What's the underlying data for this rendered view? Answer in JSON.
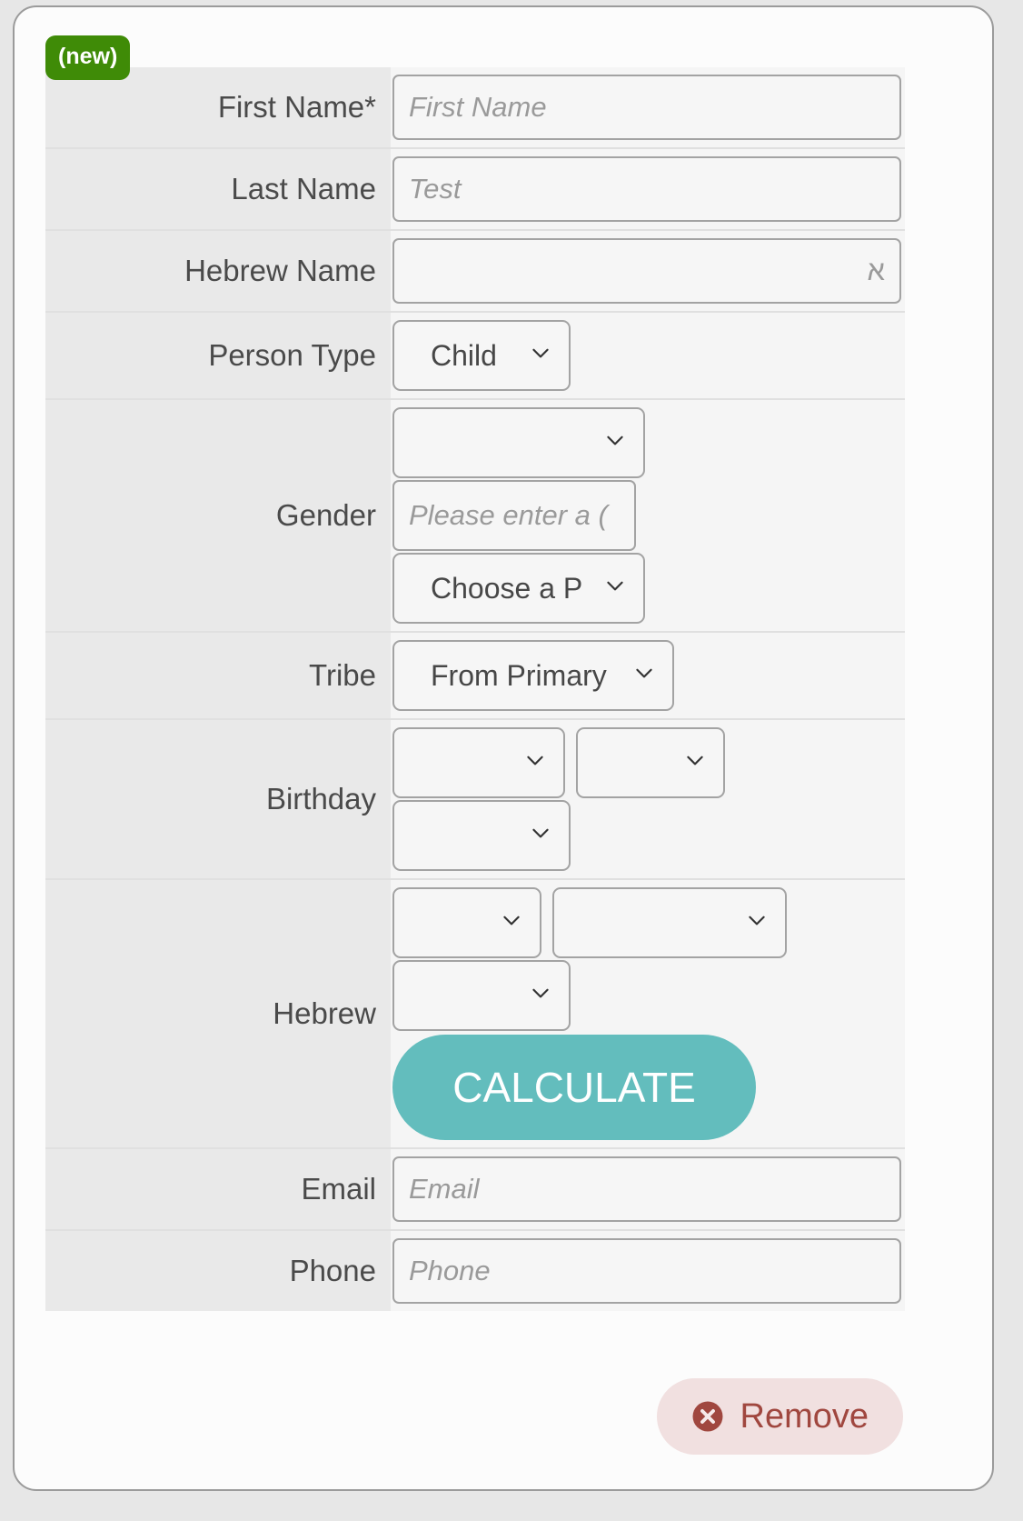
{
  "card": {
    "badge": "(new)",
    "accent_color": "#63bdbd",
    "badge_color": "#3f8b07",
    "remove_color": "#a0473f",
    "remove_bg": "#f1e0e0"
  },
  "fields": {
    "first_name": {
      "label": "First Name*",
      "placeholder": "First Name",
      "value": ""
    },
    "last_name": {
      "label": "Last Name",
      "placeholder": "Test",
      "value": ""
    },
    "hebrew_name": {
      "label": "Hebrew Name",
      "placeholder": "א",
      "value": ""
    },
    "person_type": {
      "label": "Person Type",
      "value": "Child"
    },
    "gender": {
      "label": "Gender",
      "select_value": "",
      "text_placeholder": "Please enter a (",
      "text_value": "",
      "parent_select_value": "Choose a P"
    },
    "tribe": {
      "label": "Tribe",
      "value": "From Primary"
    },
    "birthday": {
      "label": "Birthday",
      "month_value": "",
      "day_value": "",
      "year_value": ""
    },
    "hebrew": {
      "label": "Hebrew",
      "month_value": "",
      "day_value": "",
      "year_value": "",
      "calculate_label": "CALCULATE"
    },
    "email": {
      "label": "Email",
      "placeholder": "Email",
      "value": ""
    },
    "phone": {
      "label": "Phone",
      "placeholder": "Phone",
      "value": ""
    }
  },
  "footer": {
    "remove_label": "Remove",
    "remove_icon": "circle-x-icon"
  }
}
